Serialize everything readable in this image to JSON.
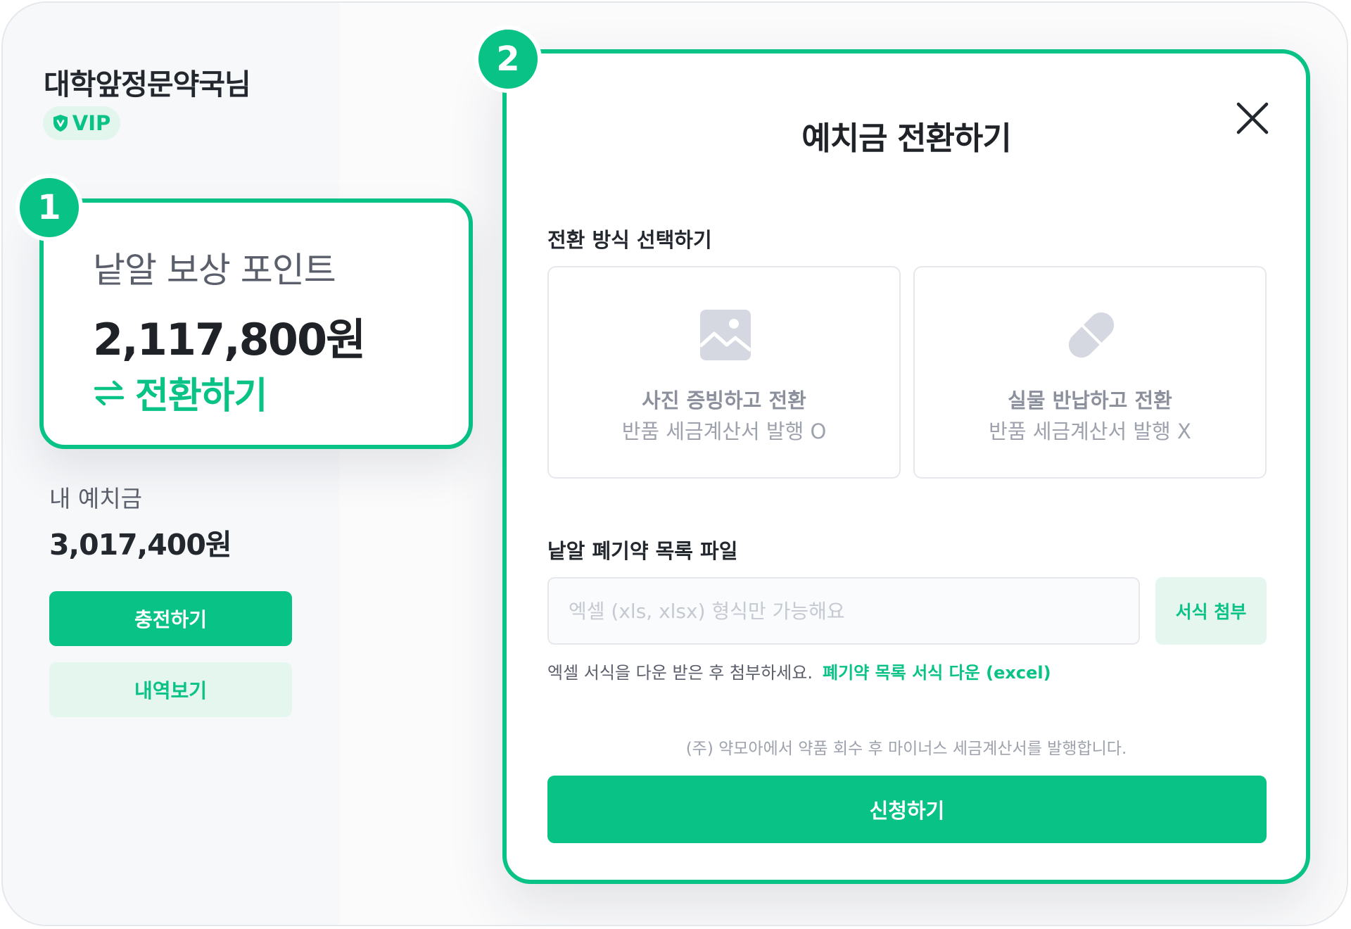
{
  "sidebar": {
    "user_name": "대학앞정문약국님",
    "badge": {
      "icon": "shield-check-icon",
      "label": "VIP"
    },
    "points_card": {
      "callout_number": "1",
      "label": "낱알 보상 포인트",
      "value": "2,117,800원",
      "convert_icon": "swap-arrows-icon",
      "convert_label": "전환하기"
    },
    "deposit": {
      "label": "내 예치금",
      "value": "3,017,400원"
    },
    "buttons": {
      "charge": "충전하기",
      "history": "내역보기"
    }
  },
  "modal": {
    "callout_number": "2",
    "title": "예치금 전환하기",
    "close_icon": "close-icon",
    "method_section_label": "전환 방식 선택하기",
    "options": [
      {
        "icon": "image-icon",
        "title": "사진 증빙하고 전환",
        "subtitle": "반품 세금계산서 발행 O"
      },
      {
        "icon": "pill-icon",
        "title": "실물 반납하고 전환",
        "subtitle": "반품 세금계산서 발행 X"
      }
    ],
    "file_section_label": "낱알 폐기약 목록 파일",
    "file_input": {
      "value": "",
      "placeholder": "엑셀 (xls, xlsx) 형식만 가능해요"
    },
    "attach_button": "서식 첨부",
    "help_text": "엑셀 서식을 다운 받은 후 첨부하세요.",
    "help_link": "폐기약 목록 서식 다운 (excel)",
    "notice": "(주) 약모아에서 약품 회수 후 마이너스 세금계산서를 발행합니다.",
    "submit_button": "신청하기"
  },
  "colors": {
    "accent": "#08c286",
    "accent_light": "#e5f6ef",
    "text_primary": "#1f2226",
    "text_muted": "#9da2ad",
    "icon_gray": "#d5d8e0"
  }
}
